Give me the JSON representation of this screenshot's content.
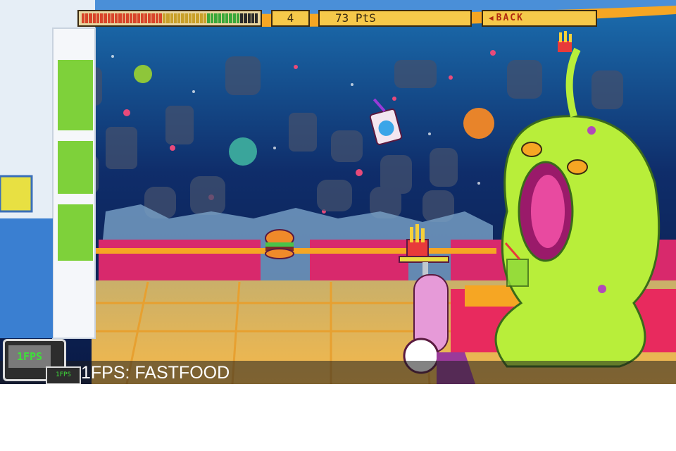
{
  "hud": {
    "energy_fraction": 0.9,
    "level": "4",
    "score": "73 PtS",
    "back_label": "BACK"
  },
  "logo": {
    "screen_text": "1FPS",
    "small_text": "1FPS"
  },
  "caption": "1FPS: FASTFOOD",
  "colors": {
    "sky": "#0d2450",
    "alien": "#b8ee3a",
    "roof": "#f6a623",
    "floor": "#f2b84b",
    "booth": "#d8296c",
    "hud_panel": "#f6c94a",
    "caption_text": "#ffffff"
  },
  "icons": [
    "burger-icon",
    "drink-cup-icon",
    "fries-icon",
    "robot-waiter-icon",
    "alien-monster-icon",
    "back-arrow-icon"
  ]
}
